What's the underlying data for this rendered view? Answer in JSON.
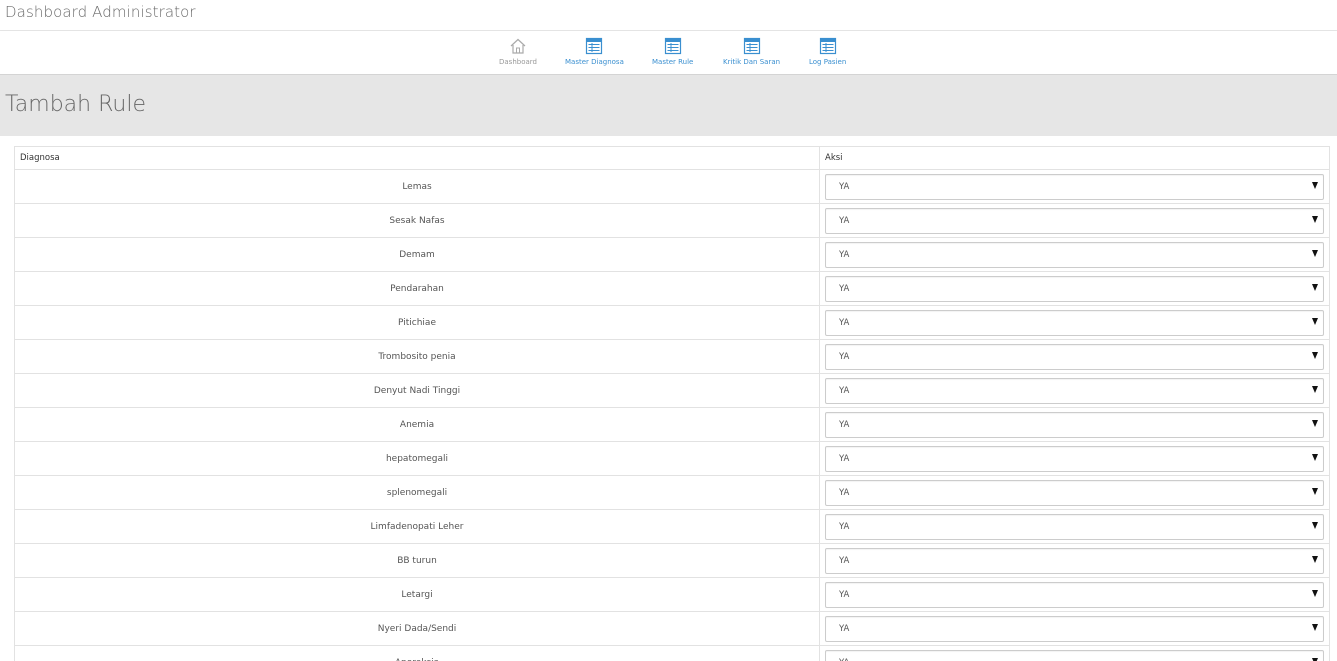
{
  "header": {
    "title": "Dashboard Administrator"
  },
  "nav": {
    "items": [
      {
        "label": "Dashboard",
        "icon": "home-icon"
      },
      {
        "label": "Master Diagnosa",
        "icon": "table-icon"
      },
      {
        "label": "Master Rule",
        "icon": "table-icon"
      },
      {
        "label": "Kritik Dan Saran",
        "icon": "table-icon"
      },
      {
        "label": "Log Pasien",
        "icon": "table-icon"
      }
    ]
  },
  "page": {
    "title": "Tambah Rule"
  },
  "table": {
    "columns": [
      "Diagnosa",
      "Aksi"
    ],
    "rows": [
      {
        "diagnosa": "Lemas",
        "aksi": "YA"
      },
      {
        "diagnosa": "Sesak Nafas",
        "aksi": "YA"
      },
      {
        "diagnosa": "Demam",
        "aksi": "YA"
      },
      {
        "diagnosa": "Pendarahan",
        "aksi": "YA"
      },
      {
        "diagnosa": "Pitichiae",
        "aksi": "YA"
      },
      {
        "diagnosa": "Trombosito penia",
        "aksi": "YA"
      },
      {
        "diagnosa": "Denyut Nadi Tinggi",
        "aksi": "YA"
      },
      {
        "diagnosa": "Anemia",
        "aksi": "YA"
      },
      {
        "diagnosa": "hepatomegali",
        "aksi": "YA"
      },
      {
        "diagnosa": "splenomegali",
        "aksi": "YA"
      },
      {
        "diagnosa": "Limfadenopati Leher",
        "aksi": "YA"
      },
      {
        "diagnosa": "BB turun",
        "aksi": "YA"
      },
      {
        "diagnosa": "Letargi",
        "aksi": "YA"
      },
      {
        "diagnosa": "Nyeri Dada/Sendi",
        "aksi": "YA"
      },
      {
        "diagnosa": "Anoreksia",
        "aksi": "YA"
      }
    ]
  },
  "colors": {
    "accent": "#3a8fd0",
    "header_band": "#e6e6e6",
    "icon_gray": "#aaaaaa"
  }
}
